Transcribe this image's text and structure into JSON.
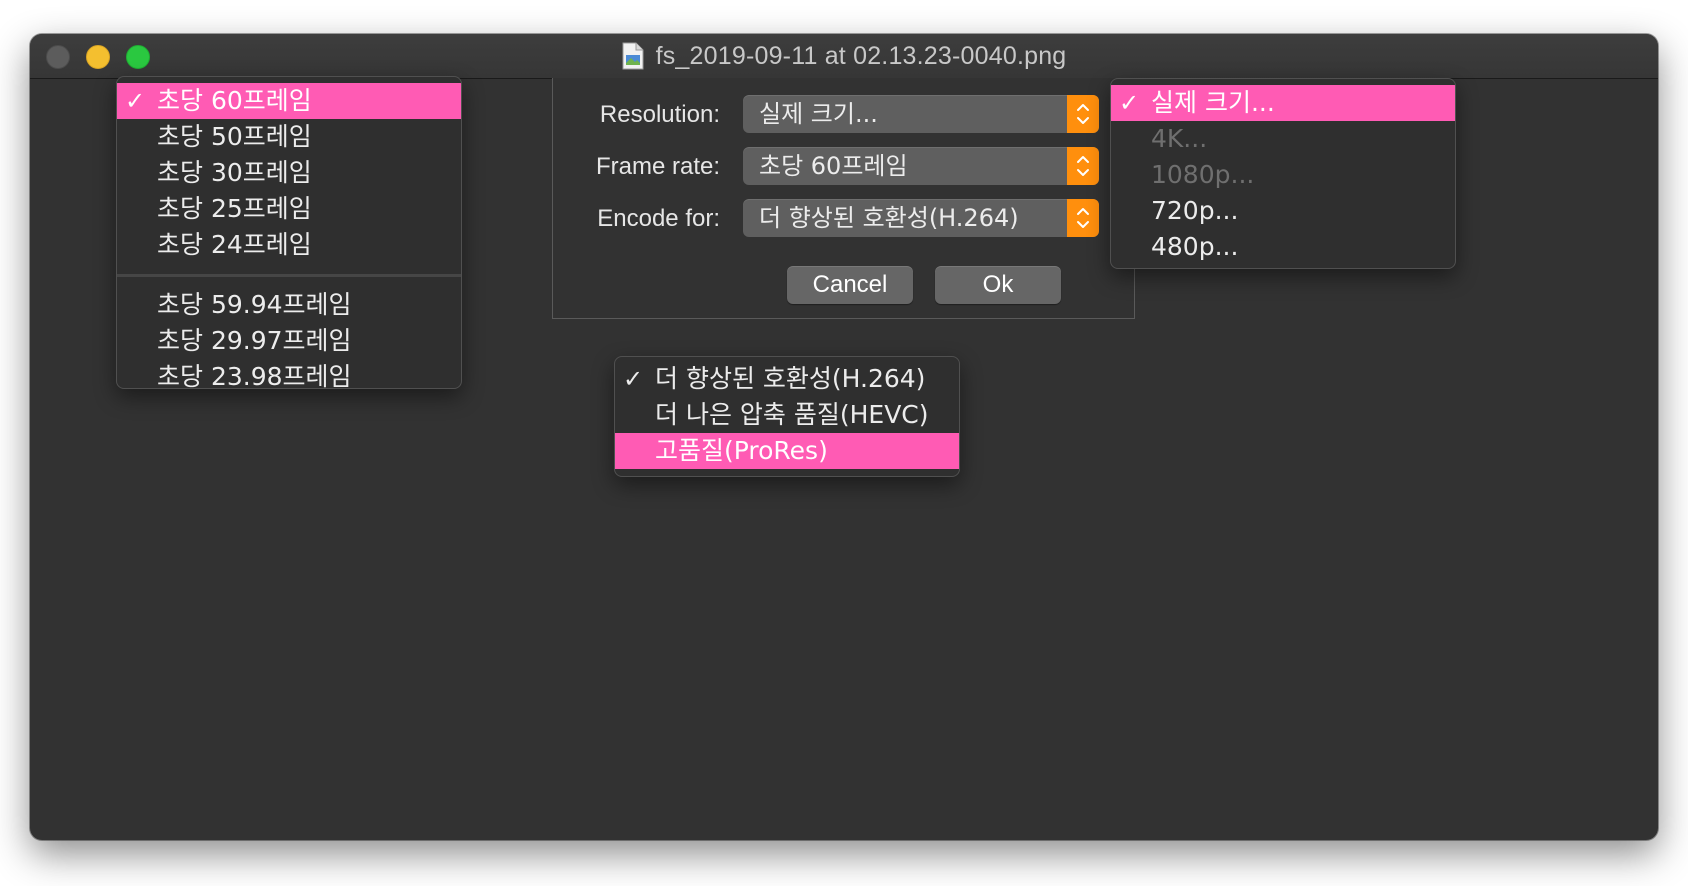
{
  "window": {
    "title": "fs_2019-09-11 at 02.13.23-0040.png"
  },
  "dialog": {
    "rows": [
      {
        "label": "Resolution:",
        "value": "실제 크기..."
      },
      {
        "label": "Frame rate:",
        "value": "초당 60프레임"
      },
      {
        "label": "Encode for:",
        "value": "더 향상된 호환성(H.264)"
      }
    ],
    "cancel_label": "Cancel",
    "ok_label": "Ok"
  },
  "framerate_menu": {
    "check": "✓",
    "items": [
      {
        "label": "초당 60프레임",
        "checked": true,
        "highlighted": true
      },
      {
        "label": "초당 50프레임"
      },
      {
        "label": "초당 30프레임"
      },
      {
        "label": "초당 25프레임"
      },
      {
        "label": "초당 24프레임"
      },
      {
        "label": "초당 59.94프레임"
      },
      {
        "label": "초당 29.97프레임"
      },
      {
        "label": "초당 23.98프레임"
      }
    ]
  },
  "resolution_menu": {
    "check": "✓",
    "items": [
      {
        "label": "실제 크기...",
        "checked": true,
        "highlighted": true
      },
      {
        "label": "4K...",
        "disabled": true
      },
      {
        "label": "1080p...",
        "disabled": true
      },
      {
        "label": "720p..."
      },
      {
        "label": "480p..."
      }
    ]
  },
  "encode_menu": {
    "check": "✓",
    "items": [
      {
        "label": "더 향상된 호환성(H.264)",
        "checked": true
      },
      {
        "label": "더 나은 압축 품질(HEVC)"
      },
      {
        "label": "고품질(ProRes)",
        "highlighted": true
      }
    ]
  },
  "colors": {
    "highlight": "#ff5bb4",
    "popup_accent": "#ff8f0d",
    "window_bg": "#323232"
  }
}
